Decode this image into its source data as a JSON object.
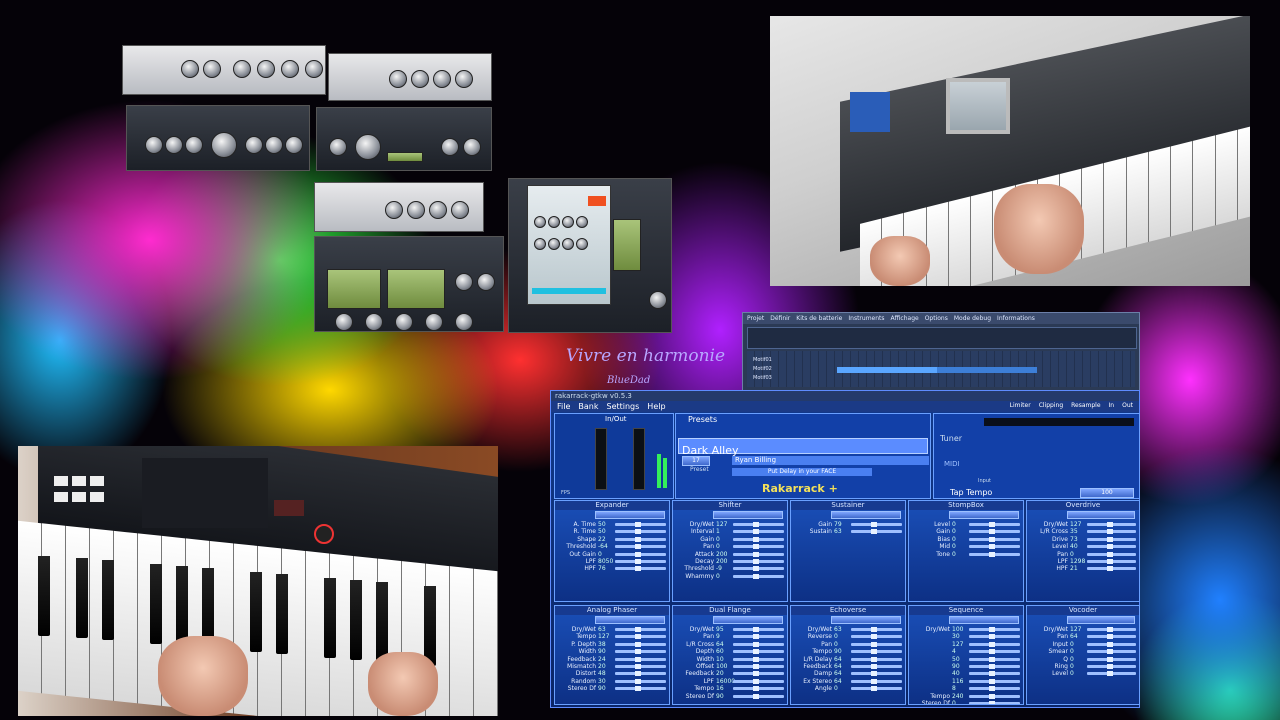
{
  "overlay": {
    "title": "Vivre en harmonie",
    "subtitle": "BlueDad"
  },
  "daw": {
    "menu": [
      "Projet",
      "Définir",
      "Kits de batterie",
      "Instruments",
      "Affichage",
      "Options",
      "Mode debug",
      "Informations"
    ],
    "tracks": [
      "Motif01",
      "Motif02",
      "Motif03"
    ]
  },
  "rakarrack": {
    "window_title": "rakarrack-gtkw  v0.5.3",
    "menu": [
      "File",
      "Bank",
      "Settings",
      "Help"
    ],
    "top_status": [
      "Limiter",
      "Clipping",
      "Resample",
      "In",
      "Out"
    ],
    "inout_label": "In/Out",
    "presets_label": "Presets",
    "preset_name": "Dark Alley",
    "preset_number": "17",
    "author": "Ryan Billing",
    "comment": "Put Delay in your FACE",
    "preset_caption": "Preset",
    "logo": "Rakarrack +",
    "tuner_label": "Tuner",
    "midi_label": "MIDI",
    "input_label": "Input",
    "tap_tempo_label": "Tap Tempo",
    "tap_value": "100",
    "fps_label": "FPS",
    "effects_row1": [
      {
        "name": "Expander",
        "rows": [
          [
            "A. Time",
            "50"
          ],
          [
            "R. Time",
            "50"
          ],
          [
            "Shape",
            "22"
          ],
          [
            "Threshold",
            "-64"
          ],
          [
            "Out Gain",
            "0"
          ],
          [
            "LPF",
            "8050"
          ],
          [
            "HPF",
            "76"
          ]
        ]
      },
      {
        "name": "Shifter",
        "rows": [
          [
            "Dry/Wet",
            "127"
          ],
          [
            "Interval",
            "1"
          ],
          [
            "Gain",
            "0"
          ],
          [
            "Pan",
            "0"
          ],
          [
            "Attack",
            "200"
          ],
          [
            "Decay",
            "200"
          ],
          [
            "Threshold",
            "-9"
          ],
          [
            "Whammy",
            "0"
          ]
        ]
      },
      {
        "name": "Sustainer",
        "rows": [
          [
            "Gain",
            "79"
          ],
          [
            "Sustain",
            "63"
          ]
        ]
      },
      {
        "name": "StompBox",
        "rows": [
          [
            "Level",
            "0"
          ],
          [
            "Gain",
            "0"
          ],
          [
            "Bias",
            "0"
          ],
          [
            "Mid",
            "0"
          ],
          [
            "Tone",
            "0"
          ]
        ]
      },
      {
        "name": "Overdrive",
        "rows": [
          [
            "Dry/Wet",
            "127"
          ],
          [
            "L/R Cross",
            "35"
          ],
          [
            "Drive",
            "73"
          ],
          [
            "Level",
            "40"
          ],
          [
            "Pan",
            "0"
          ],
          [
            "LPF",
            "1298"
          ],
          [
            "HPF",
            "21"
          ]
        ]
      }
    ],
    "effects_row2": [
      {
        "name": "Analog Phaser",
        "rows": [
          [
            "Dry/Wet",
            "63"
          ],
          [
            "Tempo",
            "127"
          ],
          [
            "P. Depth",
            "38"
          ],
          [
            "Width",
            "90"
          ],
          [
            "Feedback",
            "24"
          ],
          [
            "Mismatch",
            "20"
          ],
          [
            "Distort",
            "48"
          ],
          [
            "Random",
            "30"
          ],
          [
            "Stereo Df",
            "90"
          ]
        ]
      },
      {
        "name": "Dual Flange",
        "rows": [
          [
            "Dry/Wet",
            "95"
          ],
          [
            "Pan",
            "9"
          ],
          [
            "L/R Cross",
            "64"
          ],
          [
            "Depth",
            "60"
          ],
          [
            "Width",
            "10"
          ],
          [
            "Offset",
            "100"
          ],
          [
            "Feedback",
            "20"
          ],
          [
            "LPF",
            "16000"
          ],
          [
            "Tempo",
            "16"
          ],
          [
            "Stereo Df",
            "90"
          ]
        ]
      },
      {
        "name": "Echoverse",
        "rows": [
          [
            "Dry/Wet",
            "63"
          ],
          [
            "Reverse",
            "0"
          ],
          [
            "Pan",
            "0"
          ],
          [
            "Tempo",
            "90"
          ],
          [
            "L/R Delay",
            "64"
          ],
          [
            "Feedback",
            "64"
          ],
          [
            "Damp",
            "64"
          ],
          [
            "Ex Stereo",
            "64"
          ],
          [
            "Angle",
            "0"
          ]
        ]
      },
      {
        "name": "Sequence",
        "rows": [
          [
            "Dry/Wet",
            "100"
          ],
          [
            "",
            "30"
          ],
          [
            "",
            "127"
          ],
          [
            "",
            "4"
          ],
          [
            "",
            "50"
          ],
          [
            "",
            "90"
          ],
          [
            "",
            "40"
          ],
          [
            "",
            "116"
          ],
          [
            "",
            "8"
          ],
          [
            "Tempo",
            "240"
          ],
          [
            "Stereo Df",
            "0"
          ]
        ]
      },
      {
        "name": "Vocoder",
        "rows": [
          [
            "Dry/Wet",
            "127"
          ],
          [
            "Pan",
            "64"
          ],
          [
            "Input",
            "0"
          ],
          [
            "Smear",
            "0"
          ],
          [
            "Q",
            "0"
          ],
          [
            "Ring",
            "0"
          ],
          [
            "Level",
            "0"
          ]
        ]
      }
    ]
  }
}
